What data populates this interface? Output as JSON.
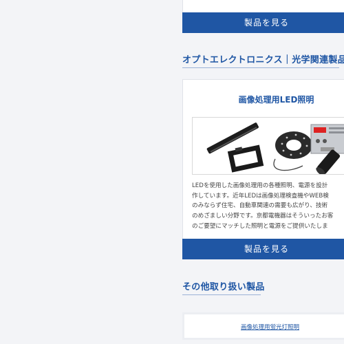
{
  "top_card": {
    "button_label": "製品を見る"
  },
  "optoelectronics": {
    "section_title": "オプトエレクトロニクス｜光学関連製品",
    "card_title": "画像処理用LED照明",
    "description_lines": [
      "LEDを使用した画像処理用の各種照明、電源を設計",
      "作しています。近年LEDは画像処理検査機やWEB検",
      "のみならず住宅、自動車関連の需要も広がり、技術",
      "のめざましい分野です。京都電機器はそういったお客",
      "のご要望にマッチした照明と電源をご提供いたしま"
    ],
    "button_label": "製品を見る"
  },
  "other_products": {
    "section_title": "その他取り扱い製品",
    "link_label": "画像処理用蛍光灯照明"
  },
  "colors": {
    "accent": "#1f56a4",
    "panel_bg": "#f3f4f7"
  }
}
